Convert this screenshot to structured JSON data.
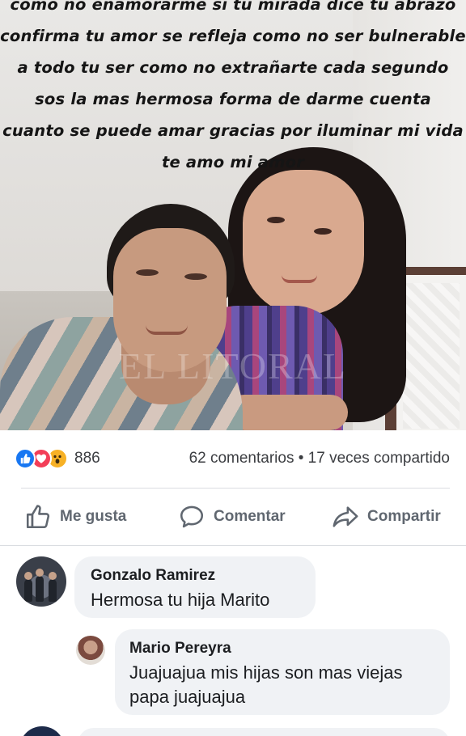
{
  "post": {
    "photo": {
      "caption_lines": [
        "como no enamorarme si tu mirada dice tu abrazo",
        "confirma tu amor se refleja como no ser bulnerable",
        "a todo tu ser como no extrañarte cada segundo",
        "sos la mas hermosa forma de darme cuenta",
        "cuanto se puede amar gracias por iluminar mi vida",
        "te amo mi amor"
      ],
      "watermark": "EL LITORAL"
    },
    "reactions": {
      "icons": [
        "like-icon",
        "love-icon",
        "wow-icon"
      ],
      "count": "886"
    },
    "counts_text": "62 comentarios • 17 veces compartido",
    "actions": {
      "like": "Me gusta",
      "comment": "Comentar",
      "share": "Compartir"
    }
  },
  "comments": [
    {
      "author": "Gonzalo Ramirez",
      "text": "Hermosa tu hija Marito"
    },
    {
      "author": "Mario Pereyra",
      "text": "Juajuajua mis hijas son mas viejas papa juajuajua",
      "is_reply": true
    }
  ],
  "colors": {
    "facebook_blue": "#1877f2",
    "love_red": "#f33e58",
    "wow_yellow": "#f7b125",
    "bubble_bg": "#f0f2f5",
    "action_gray": "#606770"
  }
}
